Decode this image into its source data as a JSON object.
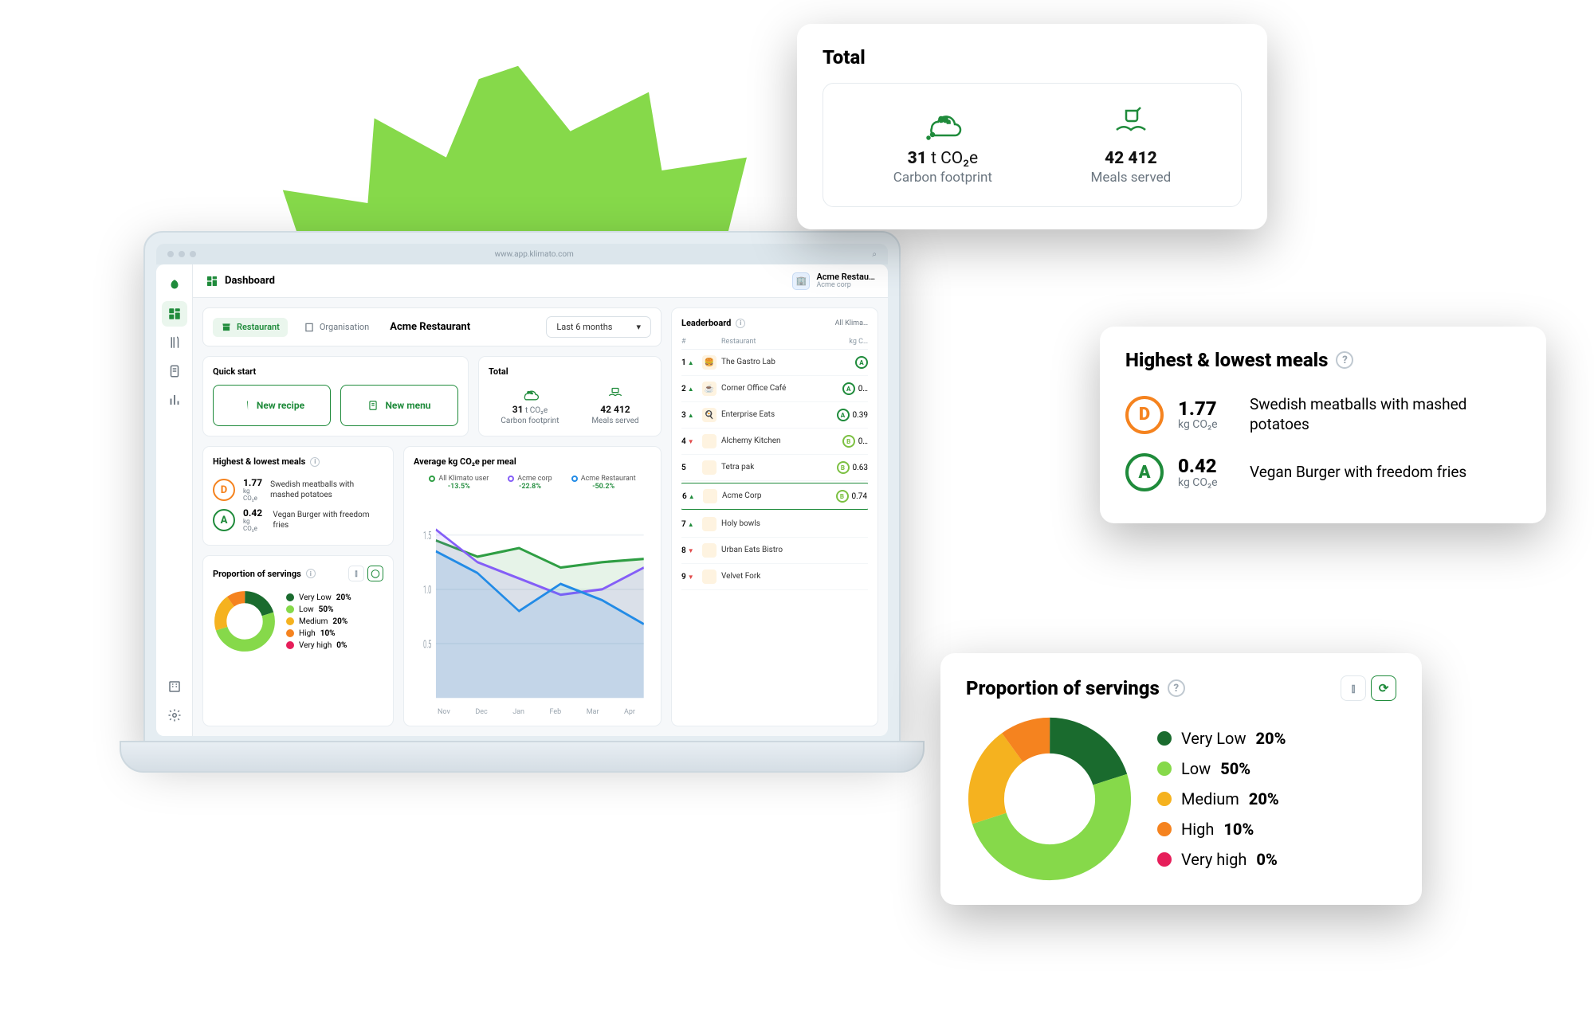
{
  "browser": {
    "url": "www.app.klimato.com"
  },
  "page": {
    "title": "Dashboard"
  },
  "org_switch": {
    "name": "Acme Restau…",
    "sub": "Acme corp",
    "avatar": "🏢"
  },
  "tabs": {
    "restaurant": "Restaurant",
    "organisation": "Organisation"
  },
  "restaurant_name": "Acme Restaurant",
  "range": {
    "label": "Last 6 months"
  },
  "quickstart": {
    "title": "Quick start",
    "recipe": "New recipe",
    "menu": "New menu"
  },
  "total": {
    "title": "Total",
    "carbon": {
      "value": "31",
      "unit": "t CO₂e",
      "label": "Carbon footprint"
    },
    "meals": {
      "value": "42 412",
      "label": "Meals served"
    }
  },
  "highlow": {
    "title": "Highest & lowest meals",
    "high": {
      "grade": "D",
      "value": "1.77",
      "unit": "kg CO₂e",
      "name": "Swedish meatballs with mashed potatoes"
    },
    "low": {
      "grade": "A",
      "value": "0.42",
      "unit": "kg CO₂e",
      "name": "Vegan Burger with freedom fries"
    }
  },
  "proportion": {
    "title": "Proportion of servings",
    "items": [
      {
        "label": "Very Low",
        "pct": "20%",
        "color": "#1a6b2e"
      },
      {
        "label": "Low",
        "pct": "50%",
        "color": "#86d94a"
      },
      {
        "label": "Medium",
        "pct": "20%",
        "color": "#f5b21f"
      },
      {
        "label": "High",
        "pct": "10%",
        "color": "#f5831f"
      },
      {
        "label": "Very high",
        "pct": "0%",
        "color": "#e61e5a"
      }
    ]
  },
  "avg_chart": {
    "title": "Average kg CO₂e per meal",
    "series": [
      {
        "name": "All Klimato user",
        "pct": "-13.5%",
        "color": "#2f9e44"
      },
      {
        "name": "Acme corp",
        "pct": "-22.8%",
        "color": "#845ef7"
      },
      {
        "name": "Acme Restaurant",
        "pct": "-50.2%",
        "color": "#228be6"
      }
    ],
    "x": [
      "Nov",
      "Dec",
      "Jan",
      "Feb",
      "Mar",
      "Apr"
    ],
    "y_ticks": [
      "1.5",
      "1.0",
      "0.5"
    ]
  },
  "leaderboard": {
    "title": "Leaderboard",
    "filter": "All Klima…",
    "cols": {
      "rank": "#",
      "rest": "Restaurant",
      "score": "kg C…"
    },
    "rows": [
      {
        "rank": "1",
        "dir": "up",
        "avatar": "🍔",
        "name": "The Gastro Lab",
        "grade": "A",
        "score": ""
      },
      {
        "rank": "2",
        "dir": "up",
        "avatar": "☕",
        "name": "Corner Office Café",
        "grade": "A",
        "score": "0…"
      },
      {
        "rank": "3",
        "dir": "up",
        "avatar": "🍳",
        "name": "Enterprise Eats",
        "grade": "A",
        "score": "0.39"
      },
      {
        "rank": "4",
        "dir": "dn",
        "avatar": "",
        "name": "Alchemy Kitchen",
        "grade": "B",
        "score": "0…"
      },
      {
        "rank": "5",
        "dir": "",
        "avatar": "",
        "name": "Tetra pak",
        "grade": "B",
        "score": "0.63"
      },
      {
        "rank": "6",
        "dir": "up",
        "avatar": "",
        "name": "Acme Corp",
        "grade": "B",
        "score": "0.74",
        "me": true
      },
      {
        "rank": "7",
        "dir": "up",
        "avatar": "",
        "name": "Holy bowls",
        "grade": "",
        "score": ""
      },
      {
        "rank": "8",
        "dir": "dn",
        "avatar": "",
        "name": "Urban Eats Bistro",
        "grade": "",
        "score": ""
      },
      {
        "rank": "9",
        "dir": "dn",
        "avatar": "",
        "name": "Velvet Fork",
        "grade": "",
        "score": ""
      }
    ]
  },
  "chart_data": {
    "type": "line",
    "title": "Average kg CO₂e per meal",
    "xlabel": "",
    "ylabel": "kg CO₂e",
    "ylim": [
      0,
      1.8
    ],
    "categories": [
      "Nov",
      "Dec",
      "Jan",
      "Feb",
      "Mar",
      "Apr"
    ],
    "series": [
      {
        "name": "All Klimato user",
        "values": [
          1.45,
          1.3,
          1.38,
          1.2,
          1.25,
          1.28
        ]
      },
      {
        "name": "Acme corp",
        "values": [
          1.55,
          1.25,
          1.1,
          0.95,
          1.0,
          1.2
        ]
      },
      {
        "name": "Acme Restaurant",
        "values": [
          1.35,
          1.15,
          0.8,
          1.05,
          0.9,
          0.68
        ]
      }
    ]
  },
  "donut_data": {
    "type": "pie",
    "slices": [
      {
        "label": "Very Low",
        "value": 20,
        "color": "#1a6b2e"
      },
      {
        "label": "Low",
        "value": 50,
        "color": "#86d94a"
      },
      {
        "label": "Medium",
        "value": 20,
        "color": "#f5b21f"
      },
      {
        "label": "High",
        "value": 10,
        "color": "#f5831f"
      },
      {
        "label": "Very high",
        "value": 0,
        "color": "#e61e5a"
      }
    ]
  }
}
